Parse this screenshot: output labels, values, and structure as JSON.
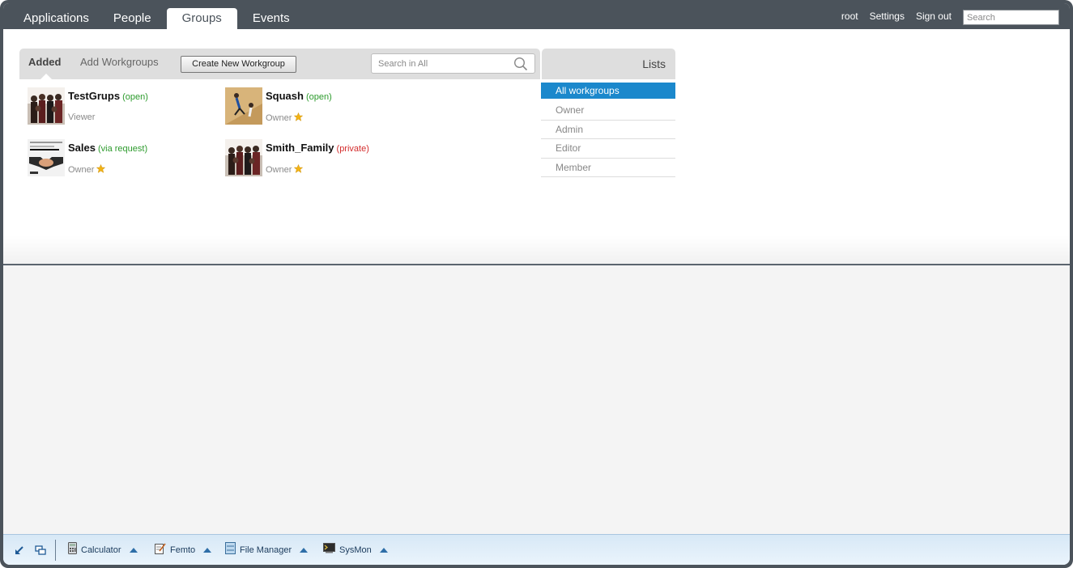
{
  "nav": {
    "tabs": [
      {
        "label": "Applications"
      },
      {
        "label": "People"
      },
      {
        "label": "Groups"
      },
      {
        "label": "Events"
      }
    ],
    "active_tab": "Groups",
    "user": "root",
    "settings_label": "Settings",
    "signout_label": "Sign out",
    "search_placeholder": "Search"
  },
  "toolbar": {
    "added_label": "Added",
    "add_workgroups_label": "Add Workgroups",
    "create_label": "Create New Workgroup",
    "search_placeholder": "Search in All"
  },
  "groups": [
    {
      "name": "TestGrups",
      "status": "(open)",
      "status_color": "#2d9b2d",
      "role": "Viewer",
      "star": false,
      "icon": "group-photo-icon"
    },
    {
      "name": "Squash",
      "status": "(open)",
      "status_color": "#2d9b2d",
      "role": "Owner",
      "star": true,
      "icon": "squash-photo-icon"
    },
    {
      "name": "Sales",
      "status": "(via request)",
      "status_color": "#2d9b2d",
      "role": "Owner",
      "star": true,
      "icon": "handshake-photo-icon"
    },
    {
      "name": "Smith_Family",
      "status": "(private)",
      "status_color": "#d42e2e",
      "role": "Owner",
      "star": true,
      "icon": "group-photo-icon"
    }
  ],
  "lists": {
    "title": "Lists",
    "items": [
      {
        "label": "All workgroups",
        "active": true
      },
      {
        "label": "Owner",
        "active": false
      },
      {
        "label": "Admin",
        "active": false
      },
      {
        "label": "Editor",
        "active": false
      },
      {
        "label": "Member",
        "active": false
      }
    ]
  },
  "taskbar": {
    "tasks": [
      {
        "label": "Calculator",
        "icon": "calculator-icon"
      },
      {
        "label": "Femto",
        "icon": "text-editor-icon"
      },
      {
        "label": "File Manager",
        "icon": "file-manager-icon"
      },
      {
        "label": "SysMon",
        "icon": "terminal-icon"
      }
    ]
  },
  "colors": {
    "chrome": "#4b535b",
    "accent": "#1b88cc",
    "open_status": "#2d9b2d",
    "private_status": "#d42e2e"
  }
}
